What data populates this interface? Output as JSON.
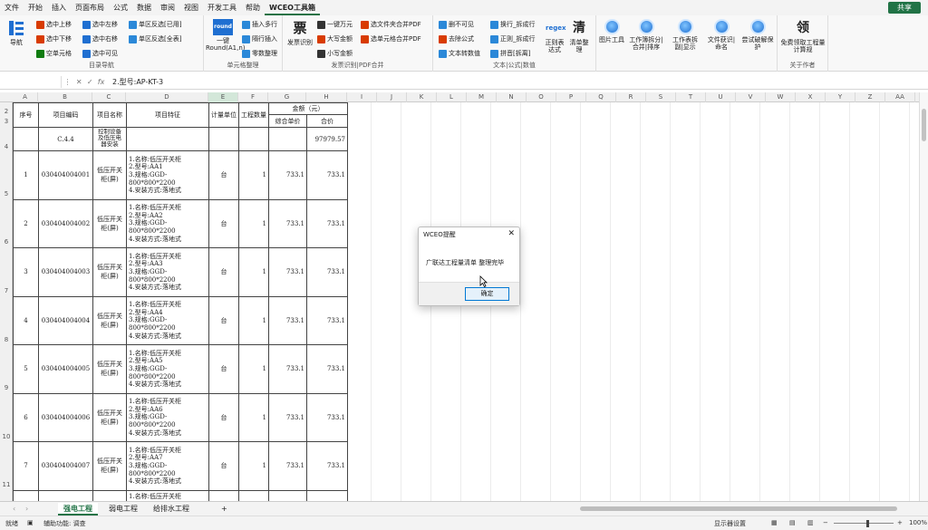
{
  "menubar": {
    "items": [
      "文件",
      "开始",
      "插入",
      "页面布局",
      "公式",
      "数据",
      "审阅",
      "视图",
      "开发工具",
      "帮助",
      "WCEO工具箱"
    ],
    "share": "共享"
  },
  "ribbon": {
    "nav": {
      "big": "导航",
      "buttons": [
        "选中上移",
        "选中左移",
        "单区反选[已用]",
        "选中下移",
        "选中右移",
        "单区反选[全表]",
        "空单元格",
        "选中可见"
      ],
      "label": "目录导航"
    },
    "cell": {
      "big_icon_text": "round",
      "big": "一键Round(A1,n)",
      "buttons": [
        "插入多行",
        "隔行插入",
        "零数整理"
      ],
      "label": "单元格整理"
    },
    "invoice": {
      "big": "发票识别",
      "buttons": [
        "一键万元",
        "选文件夹合并PDF",
        "大写金额",
        "选单元格合并PDF",
        "小写金额"
      ],
      "label": "发票识别|PDF合并"
    },
    "text": {
      "buttons": [
        "删不可见",
        "换行_拆成行",
        "去除公式",
        "正则_拆成行",
        "文本转数值",
        "拼音[拆离]"
      ],
      "regex_big": "正则表达式",
      "qing_big": "清单整理",
      "label": "文本|公式|数值"
    },
    "tools": [
      "图片工具",
      "工作簿拆分|合并|排序",
      "工作表拆副|显示",
      "文件获识|命名",
      "尝试破解保护"
    ],
    "about": {
      "big": "免费领取工程量计算规",
      "label": "关于作者"
    }
  },
  "formulabar": {
    "cell_ref": "",
    "formula": "2.型号:AP-KT-3"
  },
  "columns": [
    "A",
    "B",
    "C",
    "D",
    "E",
    "F",
    "G",
    "H",
    "I",
    "J",
    "K",
    "L",
    "M",
    "N",
    "O",
    "P",
    "Q",
    "R",
    "S",
    "T",
    "U",
    "V",
    "W",
    "X",
    "Y",
    "Z",
    "AA"
  ],
  "rows": [
    "2",
    "3",
    "4",
    "5",
    "6",
    "7",
    "8",
    "9",
    "10",
    "11"
  ],
  "sheet": {
    "headers": {
      "seq": "序号",
      "code": "项目编码",
      "name": "项目名称",
      "feature": "项目特征",
      "unit": "计量单位",
      "qty": "工程数量",
      "amount": "金额（元）",
      "unit_price": "综合单价",
      "total": "合价"
    },
    "summary": {
      "code": "C.4.4",
      "name": "控制设备及低压电器安装",
      "total": "97979.57"
    },
    "items": [
      {
        "seq": "1",
        "code": "030404004001",
        "name": "低压开关柜(屏)",
        "desc": [
          "1.名称:低压开关柜",
          "2.型号:AA1",
          "3.规格:GGD-",
          "800*800*2200",
          "4.安装方式:落地式"
        ],
        "unit": "台",
        "qty": "1",
        "price": "733.1",
        "total": "733.1"
      },
      {
        "seq": "2",
        "code": "030404004002",
        "name": "低压开关柜(屏)",
        "desc": [
          "1.名称:低压开关柜",
          "2.型号:AA2",
          "3.规格:GGD-",
          "800*800*2200",
          "4.安装方式:落地式"
        ],
        "unit": "台",
        "qty": "1",
        "price": "733.1",
        "total": "733.1"
      },
      {
        "seq": "3",
        "code": "030404004003",
        "name": "低压开关柜(屏)",
        "desc": [
          "1.名称:低压开关柜",
          "2.型号:AA3",
          "3.规格:GGD-",
          "800*800*2200",
          "4.安装方式:落地式"
        ],
        "unit": "台",
        "qty": "1",
        "price": "733.1",
        "total": "733.1"
      },
      {
        "seq": "4",
        "code": "030404004004",
        "name": "低压开关柜(屏)",
        "desc": [
          "1.名称:低压开关柜",
          "2.型号:AA4",
          "3.规格:GGD-",
          "800*800*2200",
          "4.安装方式:落地式"
        ],
        "unit": "台",
        "qty": "1",
        "price": "733.1",
        "total": "733.1"
      },
      {
        "seq": "5",
        "code": "030404004005",
        "name": "低压开关柜(屏)",
        "desc": [
          "1.名称:低压开关柜",
          "2.型号:AA5",
          "3.规格:GGD-",
          "800*800*2200",
          "4.安装方式:落地式"
        ],
        "unit": "台",
        "qty": "1",
        "price": "733.1",
        "total": "733.1"
      },
      {
        "seq": "6",
        "code": "030404004006",
        "name": "低压开关柜(屏)",
        "desc": [
          "1.名称:低压开关柜",
          "2.型号:AA6",
          "3.规格:GGD-",
          "800*800*2200",
          "4.安装方式:落地式"
        ],
        "unit": "台",
        "qty": "1",
        "price": "733.1",
        "total": "733.1"
      },
      {
        "seq": "7",
        "code": "030404004007",
        "name": "低压开关柜(屏)",
        "desc": [
          "1.名称:低压开关柜",
          "2.型号:AA7",
          "3.规格:GGD-",
          "800*800*2200",
          "4.安装方式:落地式"
        ],
        "unit": "台",
        "qty": "1",
        "price": "733.1",
        "total": "733.1"
      }
    ],
    "partial": {
      "desc": "1.名称:低压开关柜"
    }
  },
  "tabs": [
    "强电工程",
    "弱电工程",
    "给排水工程",
    "+"
  ],
  "statusbar": {
    "ready": "就绪",
    "access": "辅助功能: 调查",
    "display": "显示器设置",
    "zoom": "100%"
  },
  "dialog": {
    "title": "WCEO提醒",
    "message": "广联达工程量清单 整理完毕",
    "ok": "确定"
  },
  "colors": {
    "brand": "#217346",
    "accent": "#0078d4"
  }
}
